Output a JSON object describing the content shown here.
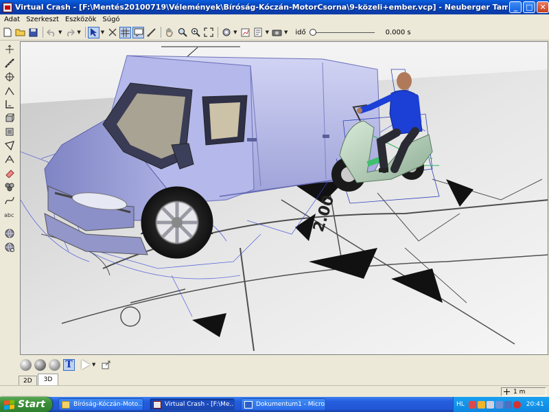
{
  "titlebar": {
    "title": "Virtual Crash - [F:\\Mentés20100719\\Vélemények\\Bíróság-Kóczán-MotorCsorna\\9-közeli+ember.vcp] - Neuberger Tamás igazságügyi szakértő [last u...",
    "minimize": "_",
    "maximize": "□",
    "close": "✕"
  },
  "menu": [
    "Adat",
    "Szerkeszt",
    "Eszközök",
    "Súgó"
  ],
  "toolbar": {
    "time_label": "idő",
    "time_value": "0.000 s",
    "time_progress": 0
  },
  "icons": {
    "new": "new-document-icon",
    "open": "open-folder-icon",
    "save": "save-icon",
    "select": "select-arrow-icon",
    "grid": "grid-icon",
    "measure": "measure-icon"
  },
  "viewport": {
    "mode": "3D",
    "dimension_text": "2.00"
  },
  "tabs": [
    "2D",
    "3D"
  ],
  "status": {
    "scale": "1 m"
  },
  "taskbar": {
    "start": "Start",
    "buttons": [
      {
        "label": "Bíróság-Kóczán-Moto...",
        "icon": "folder"
      },
      {
        "label": "Virtual Crash - [F:\\Me...",
        "icon": "vc"
      },
      {
        "label": "Dokumentum1 - Micro...",
        "icon": "word"
      }
    ],
    "lang": "HL",
    "clock": "20:41"
  },
  "colors": {
    "title_bar": "#0a5fe0",
    "taskbar": "#245edc",
    "start_button": "#3c8f3a",
    "van_body": "#b8bce8",
    "rider_shirt": "#1c3fd6"
  }
}
